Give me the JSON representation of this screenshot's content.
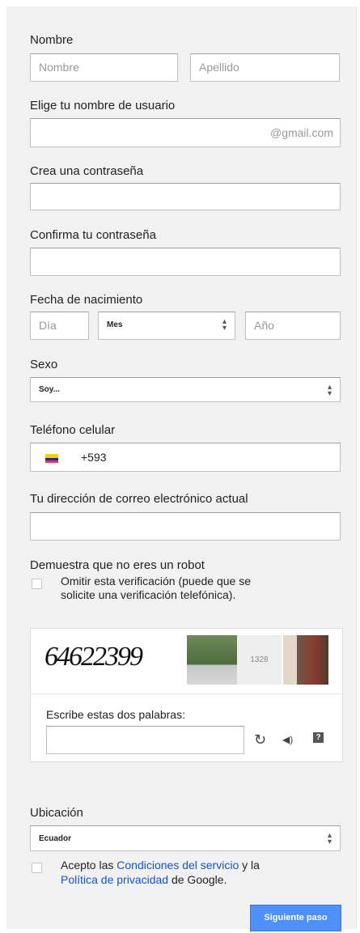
{
  "name": {
    "label": "Nombre",
    "first_placeholder": "Nombre",
    "last_placeholder": "Apellido"
  },
  "username": {
    "label": "Elige tu nombre de usuario",
    "suffix": "@gmail.com"
  },
  "password": {
    "label": "Crea una contraseña"
  },
  "confirm_password": {
    "label": "Confirma tu contraseña"
  },
  "birthdate": {
    "label": "Fecha de nacimiento",
    "day_placeholder": "Día",
    "month_value": "Mes",
    "year_placeholder": "Año"
  },
  "gender": {
    "label": "Sexo",
    "value": "Soy..."
  },
  "phone": {
    "label": "Teléfono celular",
    "prefix": "+593",
    "flag_icon": "ecuador-flag-icon"
  },
  "email": {
    "label": "Tu dirección de correo electrónico actual"
  },
  "robot": {
    "label": "Demuestra que no eres un robot",
    "skip_line1": "Omitir esta verificación (puede que se",
    "skip_line2": "solicite una verificación telefónica)."
  },
  "captcha": {
    "text": "64622399",
    "number": "1328",
    "prompt": "Escribe estas dos palabras:",
    "icons": [
      "refresh-icon",
      "audio-icon",
      "help-icon"
    ]
  },
  "location": {
    "label": "Ubicación",
    "value": "Ecuador"
  },
  "terms": {
    "prefix": "Acepto las ",
    "tos_link": "Condiciones del servicio",
    "middle": " y la",
    "privacy_link": "Política de privacidad",
    "suffix": " de Google."
  },
  "submit_label": "Siguiente paso",
  "colors": {
    "accent": "#4d90fe",
    "link": "#1155cc",
    "panel_bg": "#f1f1f1"
  }
}
